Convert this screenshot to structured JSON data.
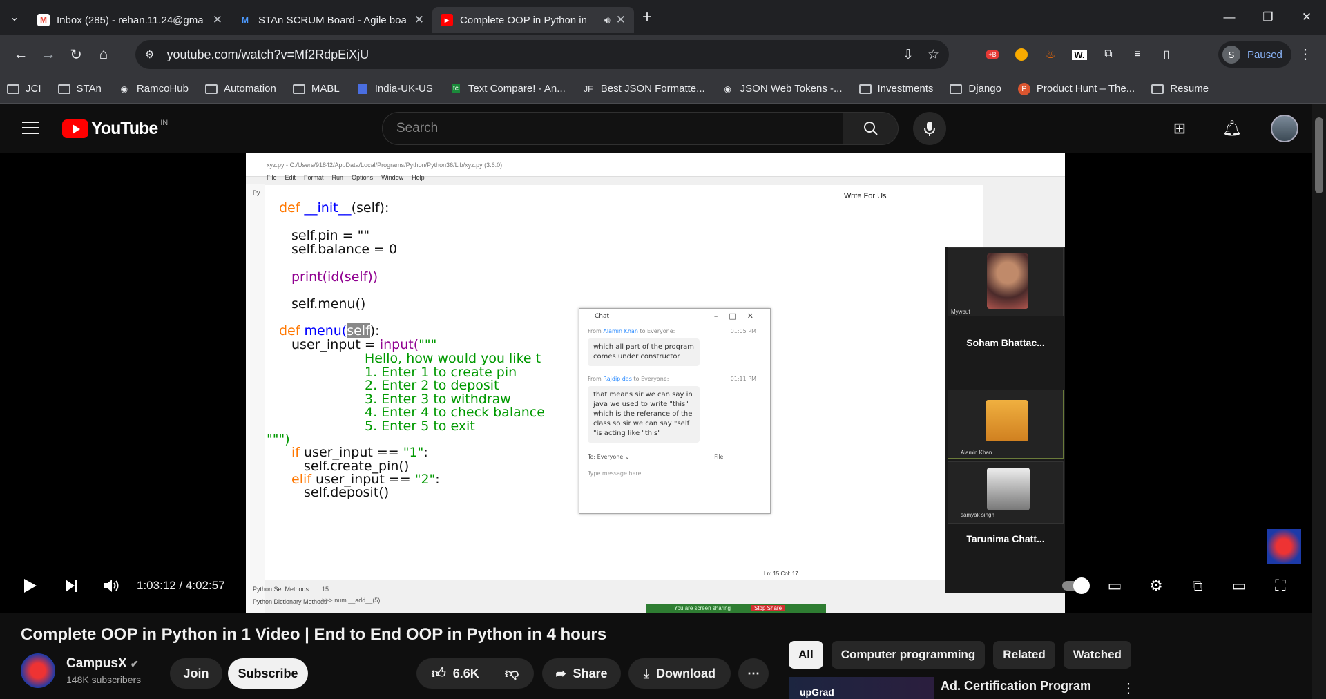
{
  "browser": {
    "tabs": [
      {
        "icon": "gmail-icon",
        "title": "Inbox (285) - rehan.11.24@gma",
        "active": false
      },
      {
        "icon": "jira-icon",
        "title": "STAn SCRUM Board - Agile boa",
        "active": false
      },
      {
        "icon": "youtube-icon",
        "title": "Complete OOP in Python in",
        "active": true
      }
    ],
    "url": "youtube.com/watch?v=Mf2RdpEiXjU",
    "profile_initial": "S",
    "profile_status": "Paused",
    "bookmarks": [
      {
        "icon": "folder",
        "label": "JCI"
      },
      {
        "icon": "folder",
        "label": "STAn"
      },
      {
        "icon": "globe",
        "label": "RamcoHub"
      },
      {
        "icon": "folder",
        "label": "Automation"
      },
      {
        "icon": "folder",
        "label": "MABL"
      },
      {
        "icon": "link",
        "label": "India-UK-US"
      },
      {
        "icon": "tc",
        "label": "Text Compare! - An..."
      },
      {
        "icon": "jf",
        "label": "Best JSON Formatte..."
      },
      {
        "icon": "globe",
        "label": "JSON Web Tokens -..."
      },
      {
        "icon": "folder",
        "label": "Investments"
      },
      {
        "icon": "folder",
        "label": "Django"
      },
      {
        "icon": "ph",
        "label": "Product Hunt – The..."
      },
      {
        "icon": "folder",
        "label": "Resume"
      }
    ]
  },
  "youtube": {
    "logo_text": "YouTube",
    "country": "IN",
    "search_placeholder": "Search"
  },
  "video_frame": {
    "ide_title": "xyz.py - C:/Users/91842/AppData/Local/Programs/Python/Python36/Lib/xyz.py (3.6.0)",
    "ide_menu": [
      "File",
      "Edit",
      "Format",
      "Run",
      "Options",
      "Window",
      "Help"
    ],
    "code": {
      "l1_kw": "def",
      "l1_fn": "__init__",
      "l1_rest": "(self):",
      "l2": "self.pin = \"\"",
      "l3": "self.balance = 0",
      "l4_bi": "print(id(self))",
      "l5": "self.menu()",
      "l6_kw": "def",
      "l6_fn": "menu(",
      "l6_sel": "self",
      "l6_rest": "):",
      "l7_a": "user_input = ",
      "l7_bi": "input(",
      "l7_st": "\"\"\"",
      "l8": "Hello, how would you like t",
      "l9": "1. Enter 1 to create pin",
      "l10": "2. Enter 2 to deposit",
      "l11": "3. Enter 3 to withdraw",
      "l12": "4. Enter 4 to check balance",
      "l13": "5. Enter 5 to exit",
      "l14": "\"\"\")",
      "l15_kw": "if",
      "l15_rest": " user_input == ",
      "l15_st": "\"1\"",
      "l15_end": ":",
      "l16": "self.create_pin()",
      "l17_kw": "elif",
      "l17_rest": " user_input == ",
      "l17_st": "\"2\"",
      "l17_end": ":",
      "l18": "self.deposit()"
    },
    "side_items": [
      "Python Set Methods",
      "Python Dictionary Methods"
    ],
    "shell": [
      "15",
      ">>> num.__add__(5)"
    ],
    "status": "Ln: 15   Col: 17",
    "chat": {
      "title": "Chat",
      "messages": [
        {
          "from_prefix": "From ",
          "from": "Alamin Khan",
          "to": " to Everyone:",
          "time": "01:05 PM",
          "text": "which all part of the program comes under constructor"
        },
        {
          "from_prefix": "From ",
          "from": "Rajdip das",
          "to": " to Everyone:",
          "time": "01:11 PM",
          "text": "that means sir we can say in java we used to write \"this\" which is the referance of the class so sir we can say \"self \"is acting like  \"this\""
        }
      ],
      "to_label": "To:",
      "to_value": "Everyone",
      "file_label": "File",
      "placeholder": "Type message here..."
    },
    "browser_hint": "Write For Us",
    "participants": [
      {
        "name": "Mywbut",
        "tile_label": "Soham  Bhattac..."
      },
      {
        "name": "Alamin Khan"
      },
      {
        "name": "samyak singh",
        "tile_label": "Tarunima  Chatt..."
      }
    ],
    "screen_share_left": "You are screen sharing",
    "screen_share_right": "Stop Share"
  },
  "player": {
    "current_time": "1:03:12",
    "duration": "4:02:57",
    "time_display": "1:03:12 / 4:02:57",
    "progress_fraction": 0.2597,
    "buffered_fraction": 0.27
  },
  "video": {
    "title": "Complete OOP in Python in 1 Video | End to End OOP in Python in 4 hours",
    "channel": "CampusX",
    "subscribers": "148K subscribers",
    "join_label": "Join",
    "subscribe_label": "Subscribe",
    "likes": "6.6K",
    "share_label": "Share",
    "download_label": "Download"
  },
  "sidebar": {
    "chips": [
      "All",
      "Computer programming",
      "Related",
      "Watched"
    ],
    "ad_title": "Ad. Certification Program",
    "ad_brand": "upGrad"
  },
  "colors": {
    "accent_red": "#ff0000",
    "bg": "#0f0f0f",
    "link_blue": "#8ab4f8"
  }
}
